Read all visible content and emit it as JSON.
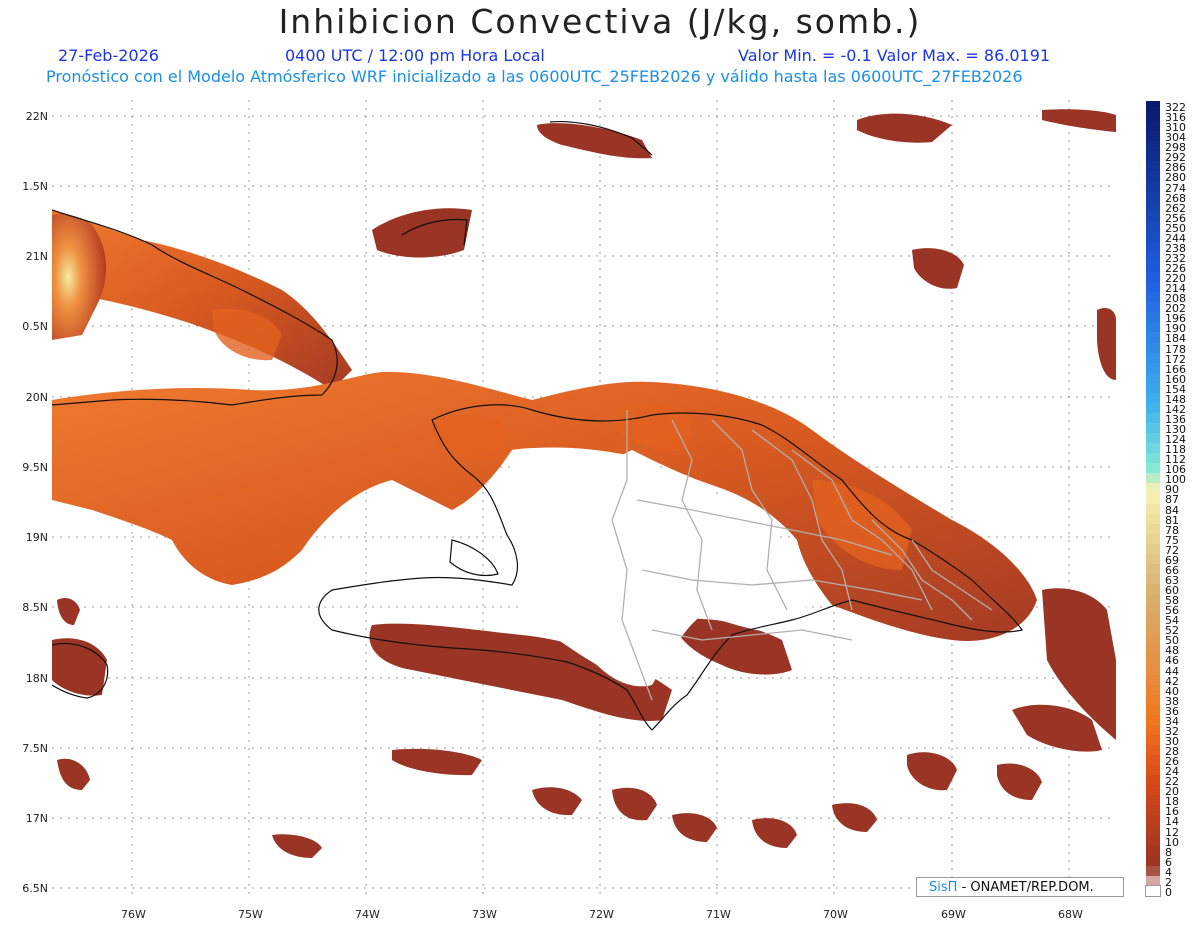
{
  "header": {
    "title": "Inhibicion Convectiva (J/kg, somb.)",
    "date": "27-Feb-2026",
    "time": "0400 UTC / 12:00 pm Hora Local",
    "minmax": "Valor Min. = -0.1  Valor Max. = 86.0191",
    "forecast_note": "Pronóstico con el Modelo Atmósferico WRF inicializado a las 0600UTC_25FEB2026 y válido hasta las  0600UTC_27FEB2026"
  },
  "axes": {
    "lat_labels": [
      "22N",
      "1.5N",
      "21N",
      "0.5N",
      "20N",
      "9.5N",
      "19N",
      "8.5N",
      "18N",
      "7.5N",
      "17N",
      "6.5N"
    ],
    "lon_labels": [
      "76W",
      "75W",
      "74W",
      "73W",
      "72W",
      "71W",
      "70W",
      "69W",
      "68W"
    ]
  },
  "legend": {
    "labels": [
      "322",
      "316",
      "310",
      "304",
      "298",
      "292",
      "286",
      "280",
      "274",
      "268",
      "262",
      "256",
      "250",
      "244",
      "238",
      "232",
      "226",
      "220",
      "214",
      "208",
      "202",
      "196",
      "190",
      "184",
      "178",
      "172",
      "166",
      "160",
      "154",
      "148",
      "142",
      "136",
      "130",
      "124",
      "118",
      "112",
      "106",
      "100",
      "90",
      "87",
      "84",
      "81",
      "78",
      "75",
      "72",
      "69",
      "66",
      "63",
      "60",
      "58",
      "56",
      "54",
      "52",
      "50",
      "48",
      "46",
      "44",
      "42",
      "40",
      "38",
      "36",
      "34",
      "32",
      "30",
      "28",
      "26",
      "24",
      "22",
      "20",
      "18",
      "16",
      "14",
      "12",
      "10",
      "8",
      "6",
      "4",
      "2",
      "0"
    ],
    "colors": {
      "dark_navy": "#0a1a6e",
      "blue": "#1f5fe0",
      "light_blue": "#3fb0ee",
      "aqua": "#7fe8d8",
      "pale_yellow": "#f6f2b0",
      "tan": "#d8b070",
      "orange": "#f07820",
      "red_orange": "#d84818",
      "brown": "#9a3424"
    }
  },
  "credit": {
    "brand": "SisΠ",
    "text": "- ONAMET/REP.DOM."
  }
}
